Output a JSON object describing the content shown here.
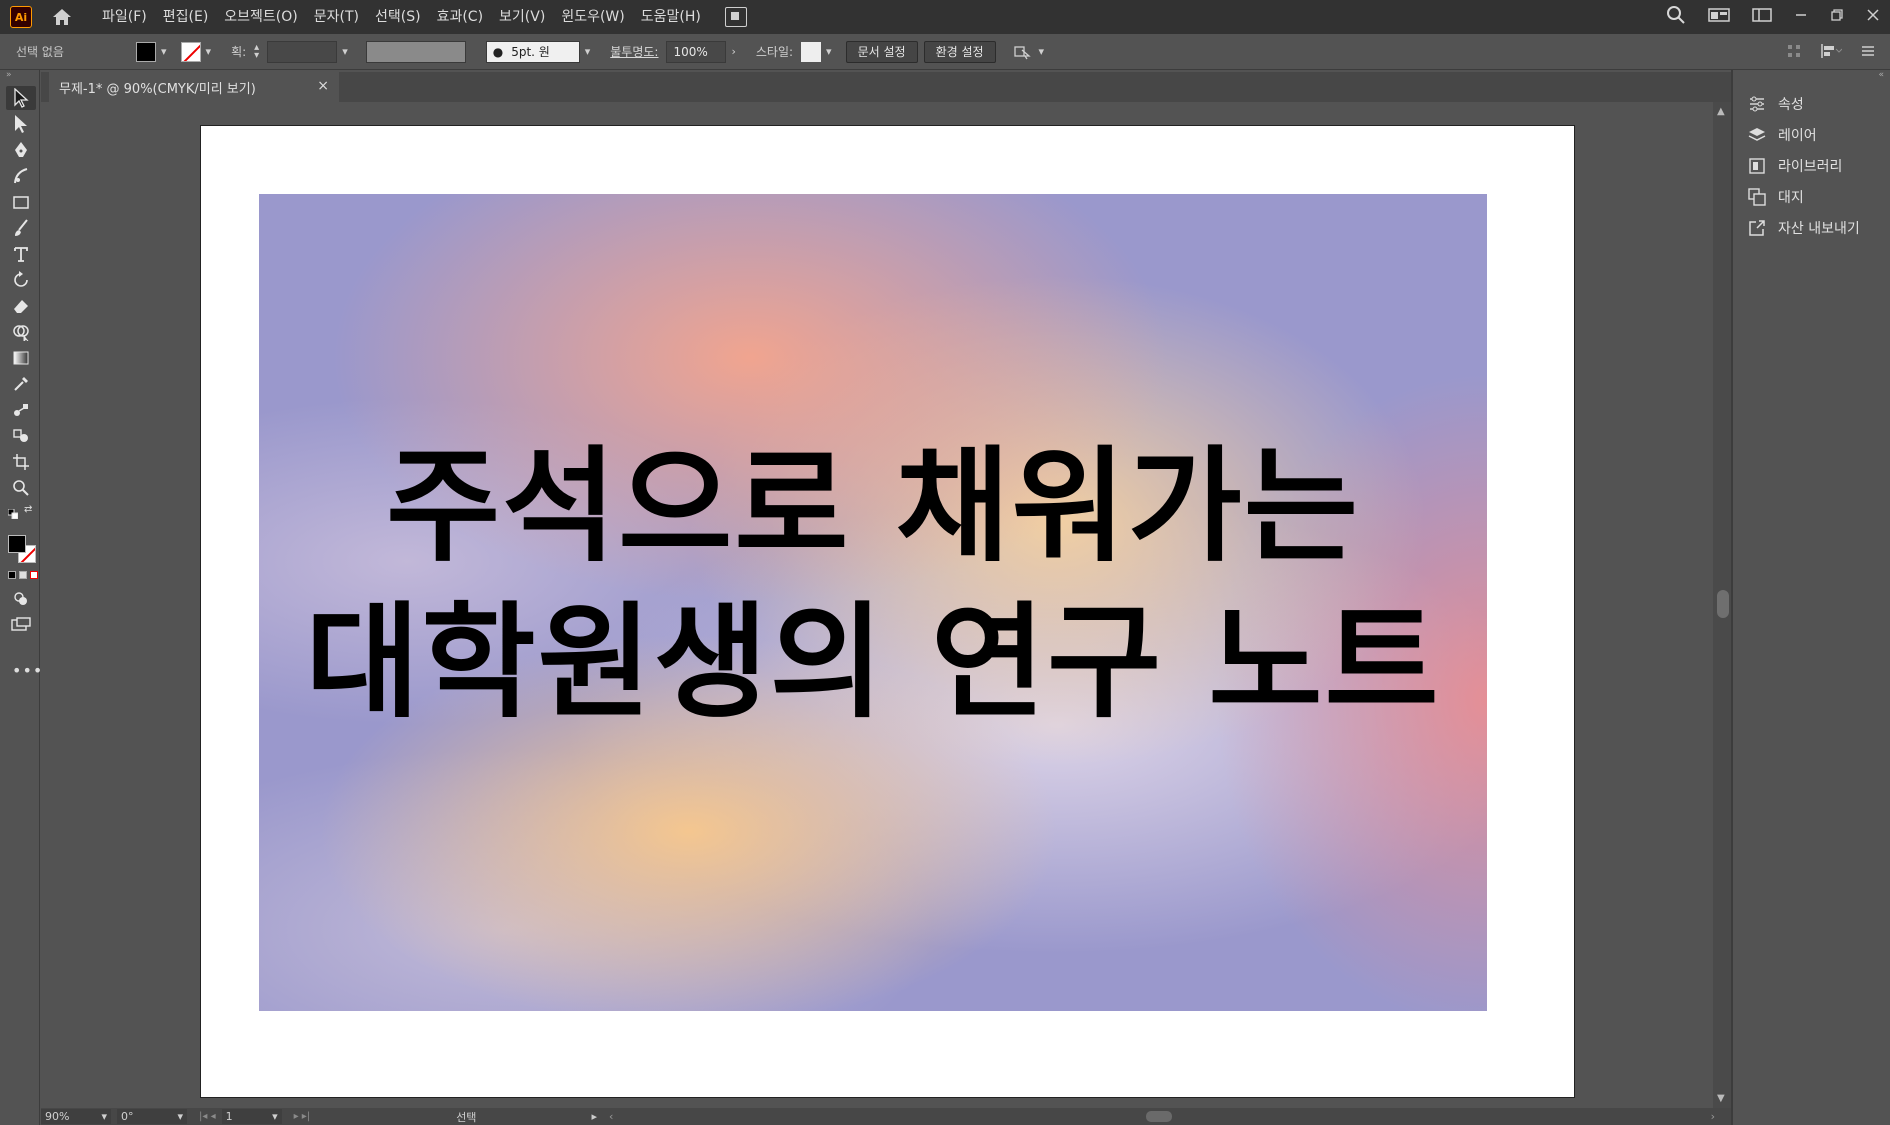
{
  "app": {
    "logo_text": "Ai"
  },
  "menu": {
    "items": [
      "파일(F)",
      "편집(E)",
      "오브젝트(O)",
      "문자(T)",
      "선택(S)",
      "효과(C)",
      "보기(V)",
      "윈도우(W)",
      "도움말(H)"
    ]
  },
  "controlbar": {
    "selection_label": "선택 없음",
    "weight_label": "획:",
    "weight_value": "",
    "brush_value": "5pt. 원",
    "opacity_label": "불투명도:",
    "opacity_value": "100%",
    "style_label": "스타일:",
    "doc_setup_label": "문서 설정",
    "prefs_label": "환경 설정"
  },
  "document": {
    "tab_title": "무제-1* @ 90%(CMYK/미리 보기)",
    "close_glyph": "×"
  },
  "artwork": {
    "title_line1": "주석으로 채워가는",
    "title_line2": "대학원생의 연구 노트"
  },
  "panel": {
    "items": [
      "속성",
      "레이어",
      "라이브러리",
      "대지",
      "자산 내보내기"
    ]
  },
  "statusbar": {
    "zoom": "90%",
    "rotation": "0°",
    "artboard_number": "1",
    "tool_status": "선택"
  },
  "colors": {
    "ui_dark": "#323232",
    "ui_mid": "#535353",
    "artwork_base": "#9a98cc",
    "gradient_peach": "#f5a58c",
    "gradient_yellow": "#f8c88c",
    "gradient_pink": "#f08c8c"
  }
}
